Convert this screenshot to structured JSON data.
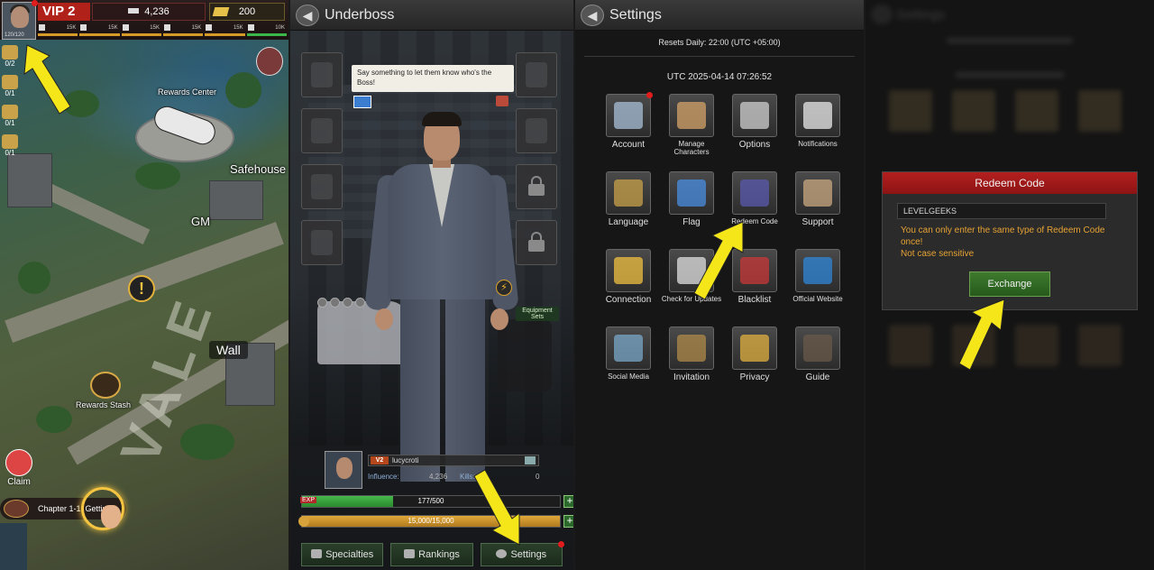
{
  "panel1": {
    "vip_label": "VIP 2",
    "avatar_stat": "120/120",
    "influence": "4,236",
    "gold": "200",
    "resources": [
      "15K",
      "15K",
      "15K",
      "15K",
      "15K",
      "10K"
    ],
    "side_counts": [
      "0/2",
      "0/1",
      "0/1",
      "0/1"
    ],
    "labels": {
      "rewards_center": "Rewards Center",
      "safehouse": "Safehouse",
      "gm": "GM",
      "wall": "Wall",
      "rewards_stash": "Rewards Stash",
      "claim": "Claim",
      "chapter": "Chapter 1-1: Getting"
    }
  },
  "panel2": {
    "title": "Underboss",
    "speech": "Say something to let them know who's the Boss!",
    "vip_tag": "V2",
    "username": "lucycroti",
    "influence_label": "Influence:",
    "influence_value": "4,236",
    "kills_label": "Kills:",
    "kills_value": "0",
    "exp_label": "EXP",
    "exp_text": "177/500",
    "exp_fraction": 0.354,
    "stamina_text": "15,000/15,000",
    "stamina_fraction": 1.0,
    "equipment_sets": "Equipment Sets",
    "buttons": {
      "specialties": "Specialties",
      "rankings": "Rankings",
      "settings": "Settings"
    }
  },
  "panel3": {
    "title": "Settings",
    "resets": "Resets Daily: 22:00 (UTC +05:00)",
    "utc": "UTC 2025-04-14 07:26:52",
    "items": [
      {
        "label": "Account",
        "icon": "account-icon",
        "small": false
      },
      {
        "label": "Manage Characters",
        "icon": "characters-icon",
        "small": true
      },
      {
        "label": "Options",
        "icon": "toggle-icon",
        "small": false
      },
      {
        "label": "Notifications",
        "icon": "bell-icon",
        "small": true
      },
      {
        "label": "Language",
        "icon": "chat-icon",
        "small": false
      },
      {
        "label": "Flag",
        "icon": "flag-icon",
        "small": false
      },
      {
        "label": "Redeem Code",
        "icon": "gift-icon",
        "small": true
      },
      {
        "label": "Support",
        "icon": "support-icon",
        "small": false
      },
      {
        "label": "Connection",
        "icon": "wifi-icon",
        "small": false
      },
      {
        "label": "Check for Updates",
        "icon": "download-icon",
        "small": true
      },
      {
        "label": "Blacklist",
        "icon": "blacklist-icon",
        "small": false
      },
      {
        "label": "Official Website",
        "icon": "globe-icon",
        "small": true
      },
      {
        "label": "Social Media",
        "icon": "social-icon",
        "small": true
      },
      {
        "label": "Invitation",
        "icon": "invitation-icon",
        "small": false
      },
      {
        "label": "Privacy",
        "icon": "shield-icon",
        "small": false
      },
      {
        "label": "Guide",
        "icon": "book-icon",
        "small": false
      }
    ]
  },
  "panel4": {
    "dialog_title": "Redeem Code",
    "code_value": "LEVELGEEKS",
    "message_line1": "You can only enter the same type of Redeem Code once!",
    "message_line2": "Not case sensitive",
    "exchange_label": "Exchange"
  },
  "colors": {
    "arrow": "#f5e61a",
    "accent_red": "#b41f1f",
    "accent_green": "#3e7a2e",
    "warn_text": "#e6a233"
  }
}
